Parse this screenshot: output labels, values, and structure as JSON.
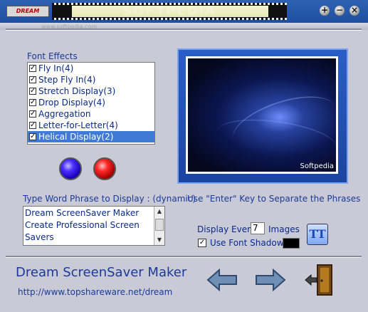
{
  "window": {
    "logo_text": "DREAM",
    "watermark": "SOFTPEDIA",
    "watermark_small": "www.softpedia.com",
    "controls": [
      "+",
      "−",
      "×"
    ]
  },
  "font_effects": {
    "label": "Font Effects",
    "items": [
      {
        "label": "Fly In(4)",
        "checked": true,
        "selected": false
      },
      {
        "label": "Step Fly In(4)",
        "checked": true,
        "selected": false
      },
      {
        "label": "Stretch Display(3)",
        "checked": true,
        "selected": false
      },
      {
        "label": "Drop Display(4)",
        "checked": true,
        "selected": false
      },
      {
        "label": "Aggregation",
        "checked": true,
        "selected": false
      },
      {
        "label": "Letter-for-Letter(4)",
        "checked": true,
        "selected": false
      },
      {
        "label": "Helical Display(2)",
        "checked": true,
        "selected": true
      }
    ]
  },
  "preview": {
    "watermark": "Softpedia"
  },
  "phrase": {
    "label": "Type Word Phrase to Display : (dynamic)",
    "hint": "Use \"Enter\" Key to Separate the Phrases",
    "text": "Dream ScreenSaver Maker\nCreate Professional Screen\nSavers"
  },
  "options": {
    "display_every_label": "Display Every",
    "display_every_value": "7",
    "images_label": "Images",
    "use_font_shadow_label": "Use Font Shadow",
    "use_font_shadow_checked": true,
    "shadow_color": "#000000",
    "font_button_label": "TT"
  },
  "footer": {
    "app_name": "Dream ScreenSaver Maker",
    "url": "http://www.topshareware.net/dream"
  }
}
